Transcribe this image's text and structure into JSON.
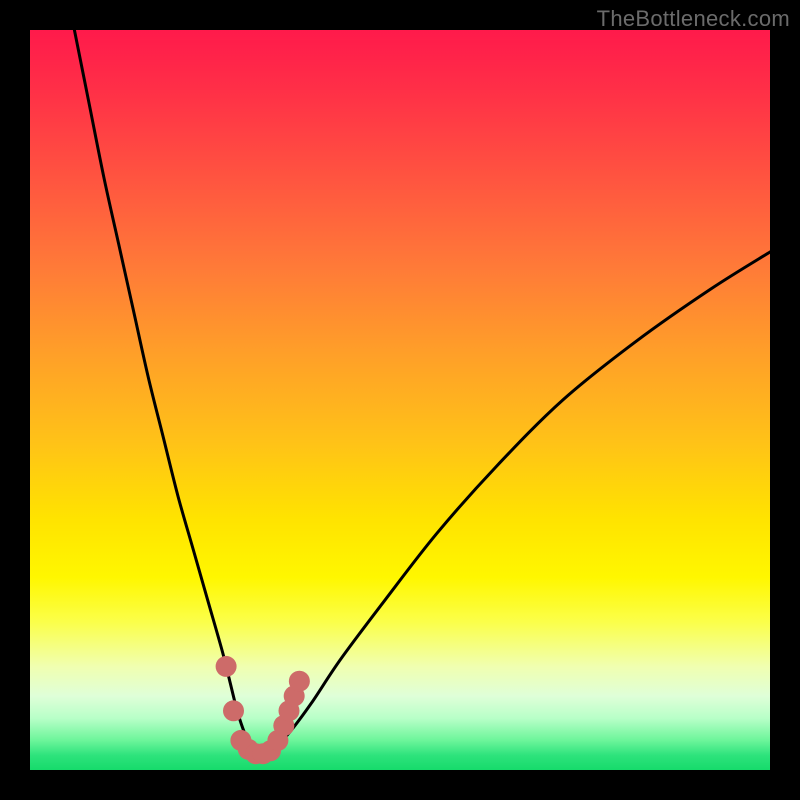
{
  "watermark": "TheBottleneck.com",
  "chart_data": {
    "type": "line",
    "title": "",
    "xlabel": "",
    "ylabel": "",
    "xlim": [
      0,
      100
    ],
    "ylim": [
      0,
      100
    ],
    "series": [
      {
        "name": "bottleneck-curve",
        "x": [
          6,
          8,
          10,
          12,
          14,
          16,
          18,
          20,
          22,
          24,
          26,
          27,
          28,
          29,
          30,
          31,
          32,
          33,
          35,
          38,
          42,
          48,
          55,
          63,
          72,
          82,
          92,
          100
        ],
        "y": [
          100,
          90,
          80,
          71,
          62,
          53,
          45,
          37,
          30,
          23,
          16,
          12,
          8,
          5,
          3,
          2,
          2,
          3,
          5,
          9,
          15,
          23,
          32,
          41,
          50,
          58,
          65,
          70
        ]
      }
    ],
    "markers": [
      {
        "name": "marker-left-upper",
        "x": 26.5,
        "y": 14
      },
      {
        "name": "marker-left-lower",
        "x": 27.5,
        "y": 8
      },
      {
        "name": "marker-bottom-1",
        "x": 28.5,
        "y": 4
      },
      {
        "name": "marker-bottom-2",
        "x": 29.5,
        "y": 2.8
      },
      {
        "name": "marker-bottom-3",
        "x": 30.5,
        "y": 2.2
      },
      {
        "name": "marker-bottom-4",
        "x": 31.5,
        "y": 2.2
      },
      {
        "name": "marker-bottom-5",
        "x": 32.5,
        "y": 2.6
      },
      {
        "name": "marker-right-1",
        "x": 33.5,
        "y": 4
      },
      {
        "name": "marker-right-2",
        "x": 34.3,
        "y": 6
      },
      {
        "name": "marker-right-3",
        "x": 35.0,
        "y": 8
      },
      {
        "name": "marker-right-4",
        "x": 35.7,
        "y": 10
      },
      {
        "name": "marker-right-5",
        "x": 36.4,
        "y": 12
      }
    ],
    "colors": {
      "curve": "#000000",
      "marker": "#cd6b69",
      "gradient_top": "#ff1a4b",
      "gradient_mid": "#ffe300",
      "gradient_bottom": "#16db6b"
    }
  }
}
